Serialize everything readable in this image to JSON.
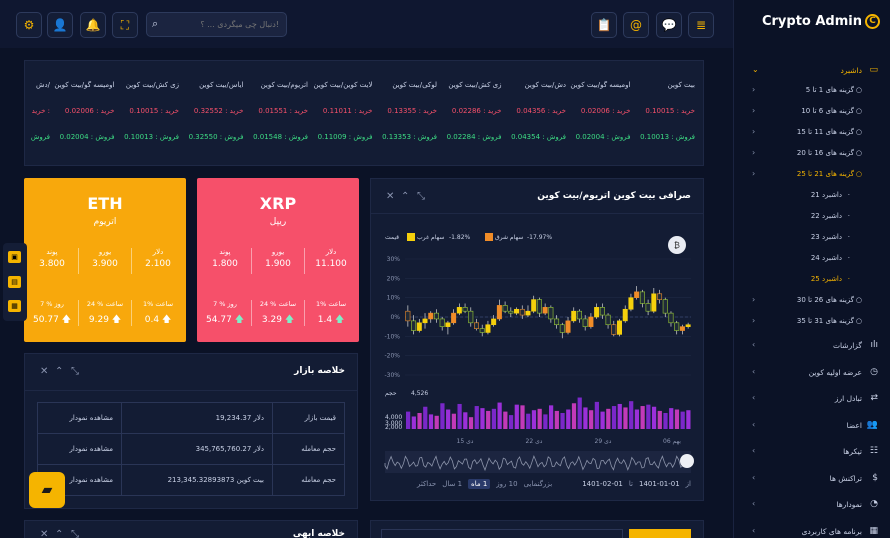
{
  "brand": {
    "name": "Crypto Admin",
    "mark": "C"
  },
  "search": {
    "placeholder": "دنبال چی میگردی ... ؟!"
  },
  "header_icons": [
    "settings-icon",
    "user-icon",
    "bell-icon",
    "fullscreen-icon",
    "search-icon",
    "clipboard-icon",
    "at-icon",
    "chat-icon",
    "menu-icon"
  ],
  "sidebar": {
    "dashboard": "داشبرد",
    "groups": [
      "گزینه های 1 تا 5",
      "گزینه های 6 تا 10",
      "گزینه های 11 تا 15",
      "گزینه های 16 تا 20",
      "گزینه های 21 تا 25"
    ],
    "items": [
      "داشبرد 21",
      "داشبرد 22",
      "داشبرد 23",
      "داشبرد 24",
      "داشبرد 25"
    ],
    "groups2": [
      "گزینه های 26 تا 30",
      "گزینه های 31 تا 35"
    ],
    "menu": [
      "گزارشات",
      "عرضه اولیه کوین",
      "تبادل ارز",
      "اعضا",
      "تیکرها",
      "تراکنش ها",
      "نمودارها",
      "برنامه های کاربردی"
    ]
  },
  "ticker": {
    "names": [
      "بیت کوین",
      "اومیسه گو/بیت کوین",
      "دش/بیت کوین",
      "زی کش/بیت کوین",
      "لوکی/بیت کوین",
      "لایت کوین/بیت کوین",
      "اتریوم/بیت کوین",
      "ایاس/بیت کوین",
      "زی کش/بیت کوین",
      "اومیسه گو/بیت کوین",
      "دش/"
    ],
    "buys": [
      "خرید : 0.10015",
      "خرید : 0.02006",
      "خرید : 0.04356",
      "خرید : 0.02286",
      "خرید : 0.13355",
      "خرید : 0.11011",
      "خرید : 0.01551",
      "خرید : 0.32552",
      "خرید : 0.10015",
      "خرید : 0.02006",
      "خرید :"
    ],
    "sells": [
      "فروش : 0.10013",
      "فروش : 0.02004",
      "فروش : 0.04354",
      "فروش : 0.02284",
      "فروش : 0.13353",
      "فروش : 0.11009",
      "فروش : 0.01548",
      "فروش : 0.32550",
      "فروش : 0.10013",
      "فروش : 0.02004",
      "فروش"
    ]
  },
  "xrp": {
    "title": "XRP",
    "subtitle": "ریپل",
    "cur": [
      "دلار",
      "یورو",
      "پوند"
    ],
    "vals": [
      "11.100",
      "1.900",
      "1.800"
    ],
    "per": [
      "1% ساعت",
      "24 % ساعت",
      "7 % روز"
    ],
    "pvals": [
      "1.4",
      "3.29",
      "54.77"
    ],
    "color": "#f6506a"
  },
  "eth": {
    "title": "ETH",
    "subtitle": "اتریوم",
    "cur": [
      "دلار",
      "یورو",
      "پوند"
    ],
    "vals": [
      "2.100",
      "3.900",
      "3.800"
    ],
    "per": [
      "1% ساعت",
      "24 % ساعت",
      "7 % روز"
    ],
    "pvals": [
      "0.4",
      "9.29",
      "50.77"
    ],
    "color": "#f8a80c"
  },
  "exchange": {
    "title": "صرافی بیت کوین اتریوم/بیت کوین",
    "legend_price": "قیمت",
    "legend_east": "سهام شرق",
    "east_val": "-17.97%",
    "legend_west": "سهام غرب",
    "west_val": "-1.82%",
    "volume_label": "حجم",
    "volume_max": "4,526",
    "vol_ticks": [
      "4,000",
      "3,000",
      "2,000"
    ],
    "x_ticks": [
      "دی 15",
      "دی 22",
      "دی 29",
      "بهم 06"
    ],
    "ranges": [
      "1 ماه",
      "10 روز",
      "1 سال",
      "حداکثر"
    ],
    "zoom_label": "بزرگنمایی",
    "from_label": "از",
    "from": "1401-01-01",
    "to_label": "تا",
    "to": "1401-02-01"
  },
  "summary": {
    "title": "خلاصه بازار",
    "rows": [
      {
        "label": "قیمت بازار",
        "value": "19,234.37 دلار",
        "link": "مشاهده نمودار"
      },
      {
        "label": "حجم معامله",
        "value": "345,765,760.27 دلار",
        "link": "مشاهده نمودار"
      },
      {
        "label": "حجم معامله",
        "value": "213,345.32893873 بیت کوین",
        "link": "مشاهده نمودار"
      }
    ]
  },
  "bottom": {
    "title": "خلاصه ابهی"
  },
  "chart_data": {
    "type": "candlestick",
    "yticks": [
      "30%",
      "20%",
      "10%",
      "0%",
      "-10%",
      "-20%",
      "-30%"
    ],
    "ylim": [
      -30,
      30
    ],
    "candles": [
      [
        3,
        -2,
        6,
        -5
      ],
      [
        -2,
        -7,
        1,
        -9
      ],
      [
        -7,
        -3,
        -1,
        -8
      ],
      [
        -3,
        -1,
        2,
        -6
      ],
      [
        -1,
        2,
        3,
        -3
      ],
      [
        2,
        -1,
        4,
        -3
      ],
      [
        -1,
        -5,
        0,
        -7
      ],
      [
        -5,
        -3,
        -2,
        -9
      ],
      [
        -3,
        2,
        4,
        -4
      ],
      [
        2,
        5,
        7,
        1
      ],
      [
        5,
        3,
        7,
        2
      ],
      [
        3,
        -3,
        5,
        -5
      ],
      [
        -3,
        -6,
        -1,
        -7
      ],
      [
        -6,
        -8,
        -4,
        -10
      ],
      [
        -8,
        -4,
        -2,
        -9
      ],
      [
        -4,
        -1,
        1,
        -5
      ],
      [
        -1,
        6,
        9,
        -2
      ],
      [
        6,
        3,
        8,
        2
      ],
      [
        3,
        2,
        5,
        0
      ],
      [
        2,
        4,
        5,
        1
      ],
      [
        4,
        1,
        6,
        -1
      ],
      [
        1,
        3,
        6,
        0
      ],
      [
        3,
        9,
        11,
        2
      ],
      [
        9,
        2,
        10,
        0
      ],
      [
        2,
        5,
        7,
        1
      ],
      [
        5,
        -1,
        6,
        -3
      ],
      [
        -1,
        -4,
        1,
        -6
      ],
      [
        -4,
        -8,
        -3,
        -11
      ],
      [
        -8,
        -2,
        0,
        -9
      ],
      [
        -2,
        3,
        5,
        -3
      ],
      [
        3,
        -1,
        4,
        -3
      ],
      [
        -1,
        -5,
        1,
        -7
      ],
      [
        -5,
        0,
        2,
        -6
      ],
      [
        0,
        5,
        7,
        -1
      ],
      [
        5,
        1,
        7,
        -1
      ],
      [
        1,
        -4,
        2,
        -6
      ],
      [
        -4,
        -9,
        -2,
        -10
      ],
      [
        -9,
        -2,
        -1,
        -10
      ],
      [
        -2,
        4,
        6,
        -3
      ],
      [
        4,
        10,
        12,
        3
      ],
      [
        10,
        13,
        16,
        9
      ],
      [
        13,
        7,
        14,
        5
      ],
      [
        7,
        3,
        9,
        1
      ],
      [
        3,
        12,
        15,
        2
      ],
      [
        12,
        9,
        14,
        7
      ],
      [
        9,
        2,
        10,
        0
      ],
      [
        2,
        -3,
        3,
        -5
      ],
      [
        -3,
        -7,
        -2,
        -9
      ],
      [
        -7,
        -5,
        -4,
        -9
      ],
      [
        -5,
        -4,
        -3,
        -6
      ]
    ],
    "volume": [
      2500,
      1800,
      2300,
      3200,
      2100,
      1900,
      3700,
      2800,
      2200,
      3600,
      2400,
      1700,
      3300,
      3000,
      2600,
      2900,
      3800,
      2500,
      2000,
      3500,
      3400,
      2200,
      2700,
      2900,
      2100,
      3400,
      2600,
      2300,
      2800,
      3700,
      4526,
      3100,
      2700,
      3900,
      2500,
      2900,
      3300,
      3600,
      3100,
      4000,
      2800,
      3300,
      3500,
      3200,
      2600,
      2300,
      3000,
      2800,
      2500,
      2700
    ]
  }
}
